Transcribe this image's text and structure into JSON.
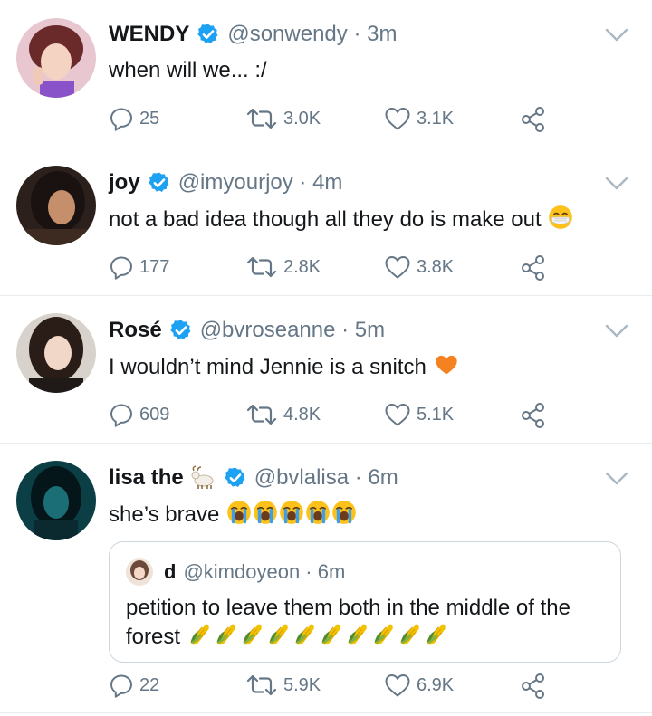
{
  "tweets": [
    {
      "name": "WENDY",
      "handle": "@sonwendy · 3m",
      "text": "when will we... :/",
      "replies": "25",
      "retweets": "3.0K",
      "likes": "3.1K"
    },
    {
      "name": "joy",
      "handle": "@imyourjoy · 4m",
      "text": "not a bad idea though all they do is make out",
      "replies": "177",
      "retweets": "2.8K",
      "likes": "3.8K"
    },
    {
      "name": "Rosé",
      "handle": "@bvroseanne · 5m",
      "text": "I wouldn’t mind Jennie is a snitch",
      "replies": "609",
      "retweets": "4.8K",
      "likes": "5.1K"
    },
    {
      "name": "lisa the",
      "handle": "@bvlalisa · 6m",
      "text": "she’s brave",
      "replies": "22",
      "retweets": "5.9K",
      "likes": "6.9K",
      "quote": {
        "name": "d",
        "handle": "@kimdoyeon · 6m",
        "text_line1": "petition to leave them both in the middle of the",
        "text_line2": "forest"
      }
    }
  ],
  "icons": {
    "verified": "verified-badge-icon",
    "reply": "reply-icon",
    "retweet": "retweet-icon",
    "like": "heart-icon",
    "share": "share-icon",
    "more": "chevron-down-icon",
    "mask_emoji": "face-with-medical-mask-emoji",
    "heart_emoji": "orange-heart-emoji",
    "crying_emoji": "loudly-crying-face-emoji",
    "corn_emoji": "ear-of-corn-emoji",
    "goat_emoji": "goat-emoji"
  },
  "colors": {
    "verified": "#1da1f2",
    "secondary_text": "#657786",
    "divider": "#e6ecf0"
  }
}
